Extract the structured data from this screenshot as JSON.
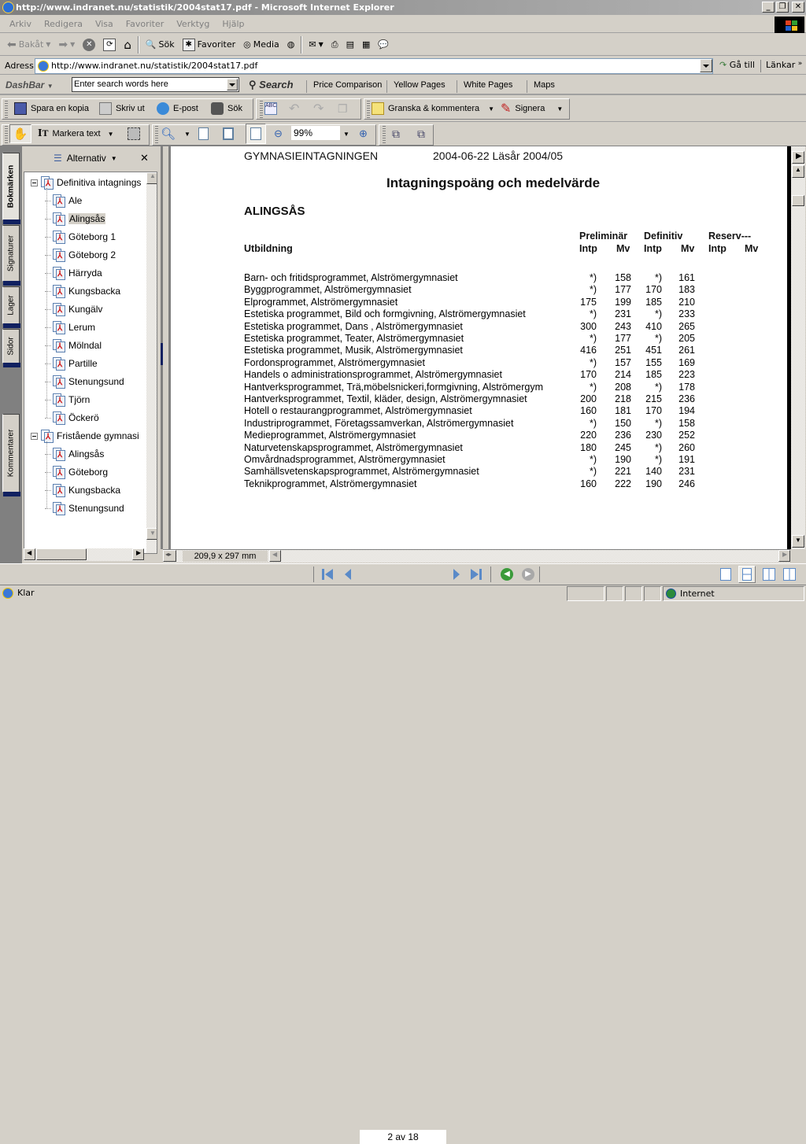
{
  "window": {
    "title": "http://www.indranet.nu/statistik/2004stat17.pdf - Microsoft Internet Explorer",
    "minimize": "_",
    "restore": "❐",
    "close": "✕"
  },
  "menu": [
    "Arkiv",
    "Redigera",
    "Visa",
    "Favoriter",
    "Verktyg",
    "Hjälp"
  ],
  "toolbar": {
    "back": "Bakåt",
    "search": "Sök",
    "favorites": "Favoriter",
    "media": "Media"
  },
  "address": {
    "label": "Adress",
    "url": "http://www.indranet.nu/statistik/2004stat17.pdf",
    "go": "Gå till",
    "links": "Länkar"
  },
  "dashbar": {
    "logo": "DashBar",
    "search_placeholder": "Enter search words here",
    "search_button": "Search",
    "links": [
      "Price Comparison",
      "Yellow Pages",
      "White Pages",
      "Maps"
    ]
  },
  "acrobat": {
    "save_copy": "Spara en kopia",
    "print": "Skriv ut",
    "email": "E-post",
    "search": "Sök",
    "review": "Granska & kommentera",
    "sign": "Signera",
    "select_text": "Markera text",
    "zoom": "99%"
  },
  "navpane": {
    "options": "Alternativ",
    "tabs": [
      "Bokmärken",
      "Signaturer",
      "Lager",
      "Sidor",
      "Kommentarer"
    ],
    "bookmarks": [
      {
        "label": "Definitiva intagnings",
        "level": 0,
        "expanded": true
      },
      {
        "label": "Ale",
        "level": 1
      },
      {
        "label": "Alingsås",
        "level": 1,
        "selected": true
      },
      {
        "label": "Göteborg 1",
        "level": 1
      },
      {
        "label": "Göteborg 2",
        "level": 1
      },
      {
        "label": "Härryda",
        "level": 1
      },
      {
        "label": "Kungsbacka",
        "level": 1
      },
      {
        "label": "Kungälv",
        "level": 1
      },
      {
        "label": "Lerum",
        "level": 1
      },
      {
        "label": "Mölndal",
        "level": 1
      },
      {
        "label": "Partille",
        "level": 1
      },
      {
        "label": "Stenungsund",
        "level": 1
      },
      {
        "label": "Tjörn",
        "level": 1
      },
      {
        "label": "Öckerö",
        "level": 1
      },
      {
        "label": "Fristående gymnasi",
        "level": 0,
        "expanded": true
      },
      {
        "label": "Alingsås",
        "level": 1
      },
      {
        "label": "Göteborg",
        "level": 1
      },
      {
        "label": "Kungsbacka",
        "level": 1
      },
      {
        "label": "Stenungsund",
        "level": 1
      }
    ]
  },
  "document": {
    "header_left": "GYMNASIEINTAGNINGEN",
    "header_right": "2004-06-22  Läsår 2004/05",
    "title": "Intagningspoäng och medelvärde",
    "municipality": "ALINGSÅS",
    "col_program": "Utbildning",
    "groups": [
      "Preliminär",
      "Definitiv",
      "Reserv---"
    ],
    "subcols": [
      "Intp",
      "Mv",
      "Intp",
      "Mv",
      "Intp",
      "Mv"
    ],
    "rows": [
      {
        "program": "Barn- och fritidsprogrammet,  Alströmergymnasiet",
        "pre_intp": "*)",
        "pre_mv": "158",
        "def_intp": "*)",
        "def_mv": "161"
      },
      {
        "program": "Byggprogrammet,  Alströmergymnasiet",
        "pre_intp": "*)",
        "pre_mv": "177",
        "def_intp": "170",
        "def_mv": "183"
      },
      {
        "program": "Elprogrammet,  Alströmergymnasiet",
        "pre_intp": "175",
        "pre_mv": "199",
        "def_intp": "185",
        "def_mv": "210"
      },
      {
        "program": "Estetiska programmet, Bild och formgivning,  Alströmergymnasiet",
        "pre_intp": "*)",
        "pre_mv": "231",
        "def_intp": "*)",
        "def_mv": "233"
      },
      {
        "program": "Estetiska programmet, Dans ,  Alströmergymnasiet",
        "pre_intp": "300",
        "pre_mv": "243",
        "def_intp": "410",
        "def_mv": "265"
      },
      {
        "program": "Estetiska programmet, Teater,  Alströmergymnasiet",
        "pre_intp": "*)",
        "pre_mv": "177",
        "def_intp": "*)",
        "def_mv": "205"
      },
      {
        "program": "Estetiska programmet, Musik,  Alströmergymnasiet",
        "pre_intp": "416",
        "pre_mv": "251",
        "def_intp": "451",
        "def_mv": "261"
      },
      {
        "program": "Fordonsprogrammet,  Alströmergymnasiet",
        "pre_intp": "*)",
        "pre_mv": "157",
        "def_intp": "155",
        "def_mv": "169"
      },
      {
        "program": "Handels o administrationsprogrammet,  Alströmergymnasiet",
        "pre_intp": "170",
        "pre_mv": "214",
        "def_intp": "185",
        "def_mv": "223"
      },
      {
        "program": "Hantverksprogrammet, Trä,möbelsnickeri,formgivning,  Alströmergym",
        "pre_intp": "*)",
        "pre_mv": "208",
        "def_intp": "*)",
        "def_mv": "178"
      },
      {
        "program": "Hantverksprogrammet, Textil, kläder, design,  Alströmergymnasiet",
        "pre_intp": "200",
        "pre_mv": "218",
        "def_intp": "215",
        "def_mv": "236"
      },
      {
        "program": "Hotell o restaurangprogrammet,  Alströmergymnasiet",
        "pre_intp": "160",
        "pre_mv": "181",
        "def_intp": "170",
        "def_mv": "194"
      },
      {
        "program": "Industriprogrammet, Företagssamverkan,  Alströmergymnasiet",
        "pre_intp": "*)",
        "pre_mv": "150",
        "def_intp": "*)",
        "def_mv": "158"
      },
      {
        "program": "Medieprogrammet,  Alströmergymnasiet",
        "pre_intp": "220",
        "pre_mv": "236",
        "def_intp": "230",
        "def_mv": "252"
      },
      {
        "program": "Naturvetenskapsprogrammet,  Alströmergymnasiet",
        "pre_intp": "180",
        "pre_mv": "245",
        "def_intp": "*)",
        "def_mv": "260"
      },
      {
        "program": "Omvårdnadsprogrammet,  Alströmergymnasiet",
        "pre_intp": "*)",
        "pre_mv": "190",
        "def_intp": "*)",
        "def_mv": "191"
      },
      {
        "program": "Samhällsvetenskapsprogrammet,  Alströmergymnasiet",
        "pre_intp": "*)",
        "pre_mv": "221",
        "def_intp": "140",
        "def_mv": "231"
      },
      {
        "program": "Teknikprogrammet,  Alströmergymnasiet",
        "pre_intp": "160",
        "pre_mv": "222",
        "def_intp": "190",
        "def_mv": "246"
      }
    ]
  },
  "docstatus": {
    "page_size": "209,9 x 297 mm",
    "page_indicator": "2 av 18"
  },
  "statusbar": {
    "text": "Klar",
    "zone": "Internet"
  }
}
